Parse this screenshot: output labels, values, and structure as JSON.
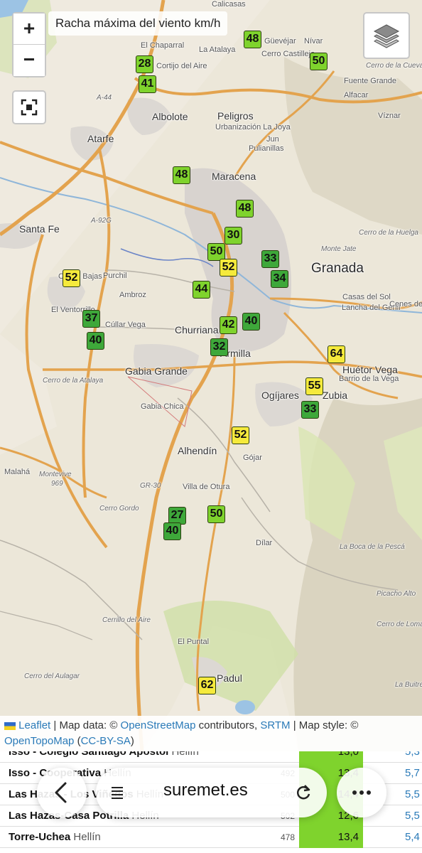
{
  "map": {
    "title": "Racha máxima del viento km/h",
    "zoom_in": "+",
    "zoom_out": "−",
    "layers_icon": "layers-icon",
    "fullscreen_icon": "fullscreen-icon",
    "places": [
      {
        "name": "Granada",
        "size": "big"
      },
      {
        "name": "Maracena",
        "size": "mid"
      },
      {
        "name": "Armilla",
        "size": "mid"
      },
      {
        "name": "Churriana",
        "size": "mid"
      },
      {
        "name": "Gabia Grande",
        "size": "mid"
      },
      {
        "name": "Albolote",
        "size": "mid"
      },
      {
        "name": "Peligros",
        "size": "mid"
      },
      {
        "name": "Atarfe",
        "size": "mid"
      },
      {
        "name": "Santa Fe",
        "size": "mid"
      },
      {
        "name": "Ogíjares",
        "size": "mid"
      },
      {
        "name": "Zubia",
        "size": "mid"
      },
      {
        "name": "Alhendín",
        "size": "mid"
      },
      {
        "name": "Huétor Vega",
        "size": "mid"
      },
      {
        "name": "Padul",
        "size": "mid"
      },
      {
        "name": "Purchil",
        "size": "sm"
      },
      {
        "name": "Casas Bajas",
        "size": "sm"
      },
      {
        "name": "Ambroz",
        "size": "sm"
      },
      {
        "name": "El Ventorrillo",
        "size": "sm"
      },
      {
        "name": "Cúllar Vega",
        "size": "sm"
      },
      {
        "name": "Gabia Chica",
        "size": "sm"
      },
      {
        "name": "Villa de Otura",
        "size": "sm"
      },
      {
        "name": "Gójar",
        "size": "sm"
      },
      {
        "name": "Dílar",
        "size": "sm"
      },
      {
        "name": "El Puntal",
        "size": "sm"
      },
      {
        "name": "Malahá",
        "size": "sm"
      },
      {
        "name": "Pulianillas",
        "size": "sm"
      },
      {
        "name": "Jun",
        "size": "sm"
      },
      {
        "name": "Urbanización La Joya",
        "size": "sm"
      },
      {
        "name": "Cortijo del Aire",
        "size": "sm"
      },
      {
        "name": "El Chaparral",
        "size": "sm"
      },
      {
        "name": "La Atalaya",
        "size": "sm"
      },
      {
        "name": "Güevéjar",
        "size": "sm"
      },
      {
        "name": "Nívar",
        "size": "sm"
      },
      {
        "name": "Cerro Castillejo",
        "size": "sm"
      },
      {
        "name": "Fuente Grande",
        "size": "sm"
      },
      {
        "name": "Alfacar",
        "size": "sm"
      },
      {
        "name": "Víznar",
        "size": "sm"
      },
      {
        "name": "Cerro de la Cueva del Agua",
        "size": "xs"
      },
      {
        "name": "Monte Jate",
        "size": "xs"
      },
      {
        "name": "Cerro de la Huelga",
        "size": "xs"
      },
      {
        "name": "Casas del Sol",
        "size": "sm"
      },
      {
        "name": "Lancha del Genil",
        "size": "sm"
      },
      {
        "name": "Cenes de",
        "size": "sm"
      },
      {
        "name": "Barrio de la Vega",
        "size": "sm"
      },
      {
        "name": "Cerro de la Atalaya",
        "size": "xs"
      },
      {
        "name": "Montevive",
        "size": "xs"
      },
      {
        "name": "969",
        "size": "xs"
      },
      {
        "name": "Cerro Gordo",
        "size": "xs"
      },
      {
        "name": "La Boca de la Pescá",
        "size": "xs"
      },
      {
        "name": "Picacho Alto",
        "size": "xs"
      },
      {
        "name": "Cerro de Loma Alta",
        "size": "xs"
      },
      {
        "name": "Cerrillo del Aire",
        "size": "xs"
      },
      {
        "name": "Cerro del Aulagar",
        "size": "xs"
      },
      {
        "name": "La Buitre",
        "size": "xs"
      },
      {
        "name": "A-92G",
        "size": "xs"
      },
      {
        "name": "A-44",
        "size": "xs"
      },
      {
        "name": "GR-30",
        "size": "xs"
      },
      {
        "name": "Calicasas",
        "size": "sm"
      }
    ],
    "markers": [
      {
        "value": "48",
        "level": "green"
      },
      {
        "value": "50",
        "level": "green"
      },
      {
        "value": "28",
        "level": "green"
      },
      {
        "value": "41",
        "level": "green"
      },
      {
        "value": "48",
        "level": "green"
      },
      {
        "value": "48",
        "level": "green"
      },
      {
        "value": "30",
        "level": "green"
      },
      {
        "value": "50",
        "level": "green"
      },
      {
        "value": "33",
        "level": "dark"
      },
      {
        "value": "52",
        "level": "yellow"
      },
      {
        "value": "34",
        "level": "dark"
      },
      {
        "value": "52",
        "level": "yellow"
      },
      {
        "value": "44",
        "level": "green"
      },
      {
        "value": "37",
        "level": "dark"
      },
      {
        "value": "42",
        "level": "green"
      },
      {
        "value": "40",
        "level": "dark"
      },
      {
        "value": "40",
        "level": "dark"
      },
      {
        "value": "32",
        "level": "dark"
      },
      {
        "value": "64",
        "level": "yellow"
      },
      {
        "value": "55",
        "level": "yellow"
      },
      {
        "value": "33",
        "level": "dark"
      },
      {
        "value": "52",
        "level": "yellow"
      },
      {
        "value": "27",
        "level": "dark"
      },
      {
        "value": "50",
        "level": "green"
      },
      {
        "value": "40",
        "level": "dark"
      },
      {
        "value": "62",
        "level": "yellow"
      }
    ],
    "colors": {
      "green": "#7fd32d",
      "dark": "#3ea83a",
      "yellow": "#f5ea3c"
    }
  },
  "attribution": {
    "leaflet": "Leaflet",
    "sep1": " | Map data: © ",
    "osm": "OpenStreetMap",
    "contributors": " contributors, ",
    "srtm": "SRTM",
    "style": " | Map style: © ",
    "otm": "OpenTopoMap",
    "open_paren": " (",
    "license": "CC-BY-SA",
    "close_paren": ")"
  },
  "table": {
    "rows": [
      {
        "name": "Isso - Colegio Santiago Apóstol",
        "town": "Hellín",
        "alt": "",
        "gust": "13,0",
        "other": "5,3"
      },
      {
        "name": "Isso - Cooperativa",
        "town": "Hellín",
        "alt": "492",
        "gust": "13,4",
        "other": "5,7"
      },
      {
        "name": "Las Hazas - Los Viñedos",
        "town": "Hellín",
        "alt": "500",
        "gust": "14,4",
        "other": "5,5"
      },
      {
        "name": "Las Hazas-Casa Potrilla",
        "town": "Hellín",
        "alt": "502",
        "gust": "12,6",
        "other": "5,5"
      },
      {
        "name": "Torre-Uchea",
        "town": "Hellín",
        "alt": "478",
        "gust": "13,4",
        "other": "5,4"
      }
    ]
  },
  "browser": {
    "url": "suremet.es",
    "back_icon": "back-arrow-icon",
    "tabs_icon": "tab-list-icon",
    "reload_icon": "reload-icon",
    "more_icon": "more-icon"
  }
}
